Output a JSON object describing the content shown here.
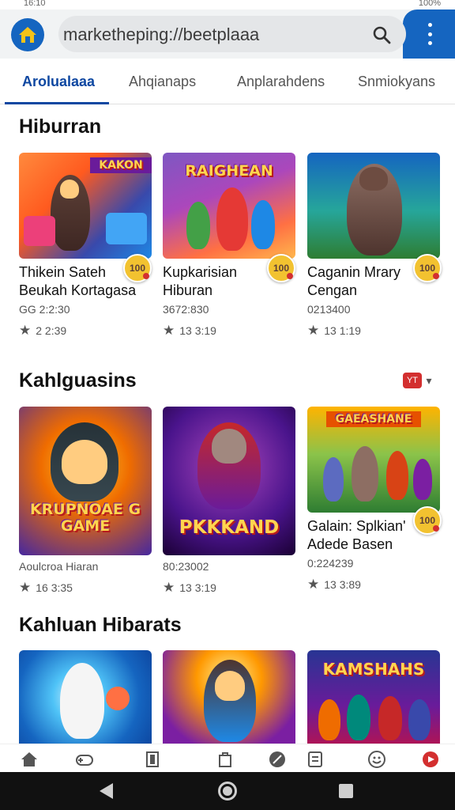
{
  "status_bar": {
    "left_text": "16:10",
    "right_text": "100%"
  },
  "browser": {
    "url": "marketheping://beetplaaa",
    "home_icon": "house-icon",
    "search_icon": "magnifier-icon",
    "menu_icon": "kebab-menu-icon"
  },
  "tabs": [
    {
      "label": "Arolualaaa",
      "active": true
    },
    {
      "label": "Ahqianaps",
      "active": false
    },
    {
      "label": "Anplarahdens",
      "active": false
    },
    {
      "label": "Snmiokyans",
      "active": false
    }
  ],
  "sections": [
    {
      "title": "Hiburran",
      "cards": [
        {
          "name1": "Thikein Sateh",
          "name2": "Beukah Kortagasa",
          "dev": "GG 2:2:30",
          "meta": "2 2:39",
          "art_title": "KAKON",
          "price": "100"
        },
        {
          "name1": "Kupkarisian",
          "name2": "Hiburan",
          "dev": "3672:830",
          "meta": "13 3:19",
          "art_title": "RAIGHEAN",
          "price": "100"
        },
        {
          "name1": "Caganin Mrary",
          "name2": "Cengan",
          "dev": "0213400",
          "meta": "13 1:19",
          "art_title": "",
          "price": "100"
        }
      ]
    },
    {
      "title": "Kahlguasins",
      "badge": "YT",
      "cards": [
        {
          "name1": "",
          "name2": "",
          "dev": "Aoulcroa Hiaran",
          "meta": "16 3:35",
          "art_title": "KRUPNOAE G GAME",
          "price": ""
        },
        {
          "name1": "",
          "name2": "",
          "dev": "80:23002",
          "meta": "13 3:19",
          "art_title": "PKKKAND",
          "price": ""
        },
        {
          "name1": "Galain: Splkian'",
          "name2": "Adede Basen",
          "dev": "0:224239",
          "meta": "13 3:89",
          "art_title": "GAEASHANE",
          "price": "100"
        }
      ]
    },
    {
      "title": "Kahluan Hibarats",
      "cards": [
        {
          "art_title": ""
        },
        {
          "art_title": ""
        },
        {
          "art_title": "KAMSHAHS"
        }
      ]
    }
  ],
  "bottom_nav": [
    "home-icon",
    "gamepad-icon",
    "book-icon",
    "bag-icon",
    "compass-icon",
    "list-icon",
    "profile-icon",
    "youtube-icon"
  ],
  "colors": {
    "accent": "#1565c0",
    "tab_active": "#0d47a1",
    "badge": "#f2c230"
  }
}
